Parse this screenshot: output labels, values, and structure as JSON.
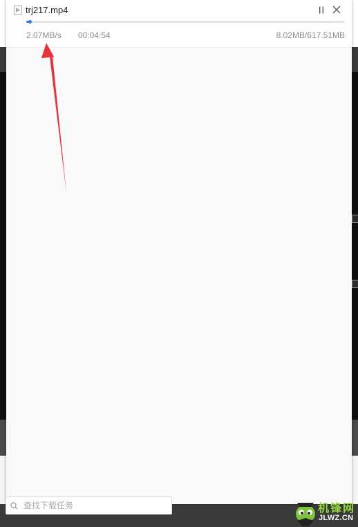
{
  "task": {
    "file_name": "trj217.mp4",
    "speed": "2.07MB/s",
    "time_remaining": "00:04:54",
    "size_progress": "8.02MB/617.51MB",
    "progress_fraction": 0.013
  },
  "search": {
    "placeholder": "查找下载任务"
  },
  "watermark": {
    "cjk_text": "机锋网",
    "latin_text": "JLWZ.CN"
  },
  "colors": {
    "progress": "#2d7be5",
    "arrow": "#e8323a",
    "watermark_green": "#8fd63b"
  },
  "icons": [
    "video-file-icon",
    "pause-icon",
    "close-icon",
    "search-icon"
  ]
}
